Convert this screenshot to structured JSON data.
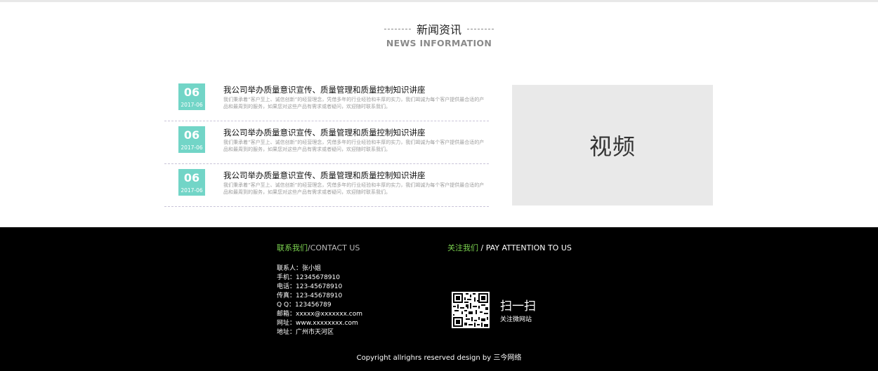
{
  "heading": {
    "cn": "新闻资讯",
    "en": "NEWS INFORMATION"
  },
  "news": [
    {
      "day": "06",
      "ym": "2017-06",
      "title": "我公司举办质量意识宣传、质量管理和质量控制知识讲座",
      "desc": "我们秉承着“客户至上、诚信创新”的经营理念，凭借多年的行业经验和丰厚的实力，我们竭诚为每个客户提供最合适的产品和最周到的服务，如果您对这些产品有需求或者疑问，欢迎随时联系我们。"
    },
    {
      "day": "06",
      "ym": "2017-06",
      "title": "我公司举办质量意识宣传、质量管理和质量控制知识讲座",
      "desc": "我们秉承着“客户至上、诚信创新”的经营理念，凭借多年的行业经验和丰厚的实力，我们竭诚为每个客户提供最合适的产品和最周到的服务，如果您对这些产品有需求或者疑问，欢迎随时联系我们。"
    },
    {
      "day": "06",
      "ym": "2017-06",
      "title": "我公司举办质量意识宣传、质量管理和质量控制知识讲座",
      "desc": "我们秉承着“客户至上、诚信创新”的经营理念，凭借多年的行业经验和丰厚的实力，我们竭诚为每个客户提供最合适的产品和最周到的服务，如果您对这些产品有需求或者疑问，欢迎随时联系我们。"
    }
  ],
  "video": {
    "label": "视频"
  },
  "footer": {
    "contact": {
      "title_cn": "联系我们",
      "title_en": "/CONTACT US",
      "lines": [
        "联系人：张小姐",
        "手机：12345678910",
        "电话：123-45678910",
        "传真：123-45678910",
        "Q Q：123456789",
        "邮箱：xxxxx@xxxxxxx.com",
        "网址：www.xxxxxxxx.com",
        "地址：广州市天河区"
      ]
    },
    "follow": {
      "title_cn": "关注我们",
      "title_en": " / PAY ATTENTION TO US",
      "scan": "扫一扫",
      "scan_sub": "关注微网站"
    },
    "copyright": "Copyright allrighrs reserved  design by 三今网络"
  },
  "colors": {
    "accent": "#72d5c7",
    "footer_bg": "#000000",
    "green": "#7bd24f",
    "video_bg": "#e9e9e9"
  },
  "icons": {
    "qr": "qr-code-icon"
  }
}
